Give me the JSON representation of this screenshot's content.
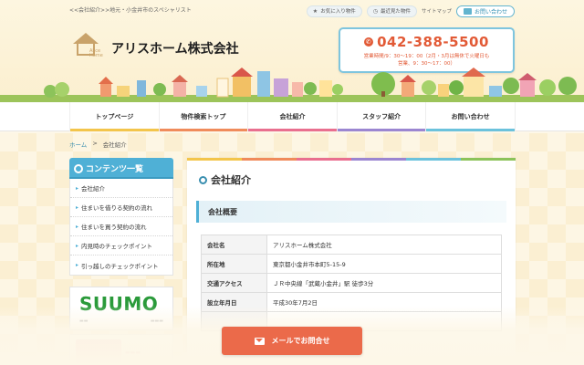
{
  "header": {
    "tagline": "<<会社紹介>>地元・小金井市のスペシャリスト",
    "favorites_label": "お気に入り物件",
    "history_label": "最近見た物件",
    "sitemap_label": "サイトマップ",
    "contact_label": "お問い合わせ",
    "company_name": "アリスホーム株式会社",
    "logo_sub": "Alice Home",
    "phone": "042-388-5500",
    "hours_line1": "営業時間/9：30〜19：00（2月・3月は無休で火曜日も",
    "hours_line2": "営業、9：30〜17：00）"
  },
  "nav": {
    "items": [
      {
        "label": "トップページ",
        "color": "#f3c54b"
      },
      {
        "label": "物件検索トップ",
        "color": "#f08b5b"
      },
      {
        "label": "会社紹介",
        "color": "#e96f8f"
      },
      {
        "label": "スタッフ紹介",
        "color": "#9b86d1"
      },
      {
        "label": "お問い合わせ",
        "color": "#6bc2dc"
      }
    ]
  },
  "breadcrumb": {
    "home": "ホーム",
    "separator": ">",
    "current": "会社紹介"
  },
  "sidebar": {
    "title": "コンテンツ一覧",
    "items": [
      {
        "label": "会社紹介"
      },
      {
        "label": "住まいを借りる契約の流れ"
      },
      {
        "label": "住まいを買う契約の流れ"
      },
      {
        "label": "内見時のチェックポイント"
      },
      {
        "label": "引っ越しのチェックポイント"
      }
    ],
    "suumo_label": "SUUMO"
  },
  "main": {
    "title": "会社紹介",
    "section_title": "会社概要",
    "rows": [
      {
        "key": "会社名",
        "value": "アリスホーム株式会社"
      },
      {
        "key": "所在地",
        "value": "東京都小金井市本町5-15-9"
      },
      {
        "key": "交通アクセス",
        "value": "ＪＲ中央線「武蔵小金井」駅 徒歩3分"
      },
      {
        "key": "設立年月日",
        "value": "平成30年7月2日"
      }
    ]
  },
  "cta": {
    "mail_label": "メールでお問合せ"
  },
  "colors": {
    "accent": "#4fb0d6",
    "phone": "#e25a36",
    "cta": "#eb6a4a"
  }
}
